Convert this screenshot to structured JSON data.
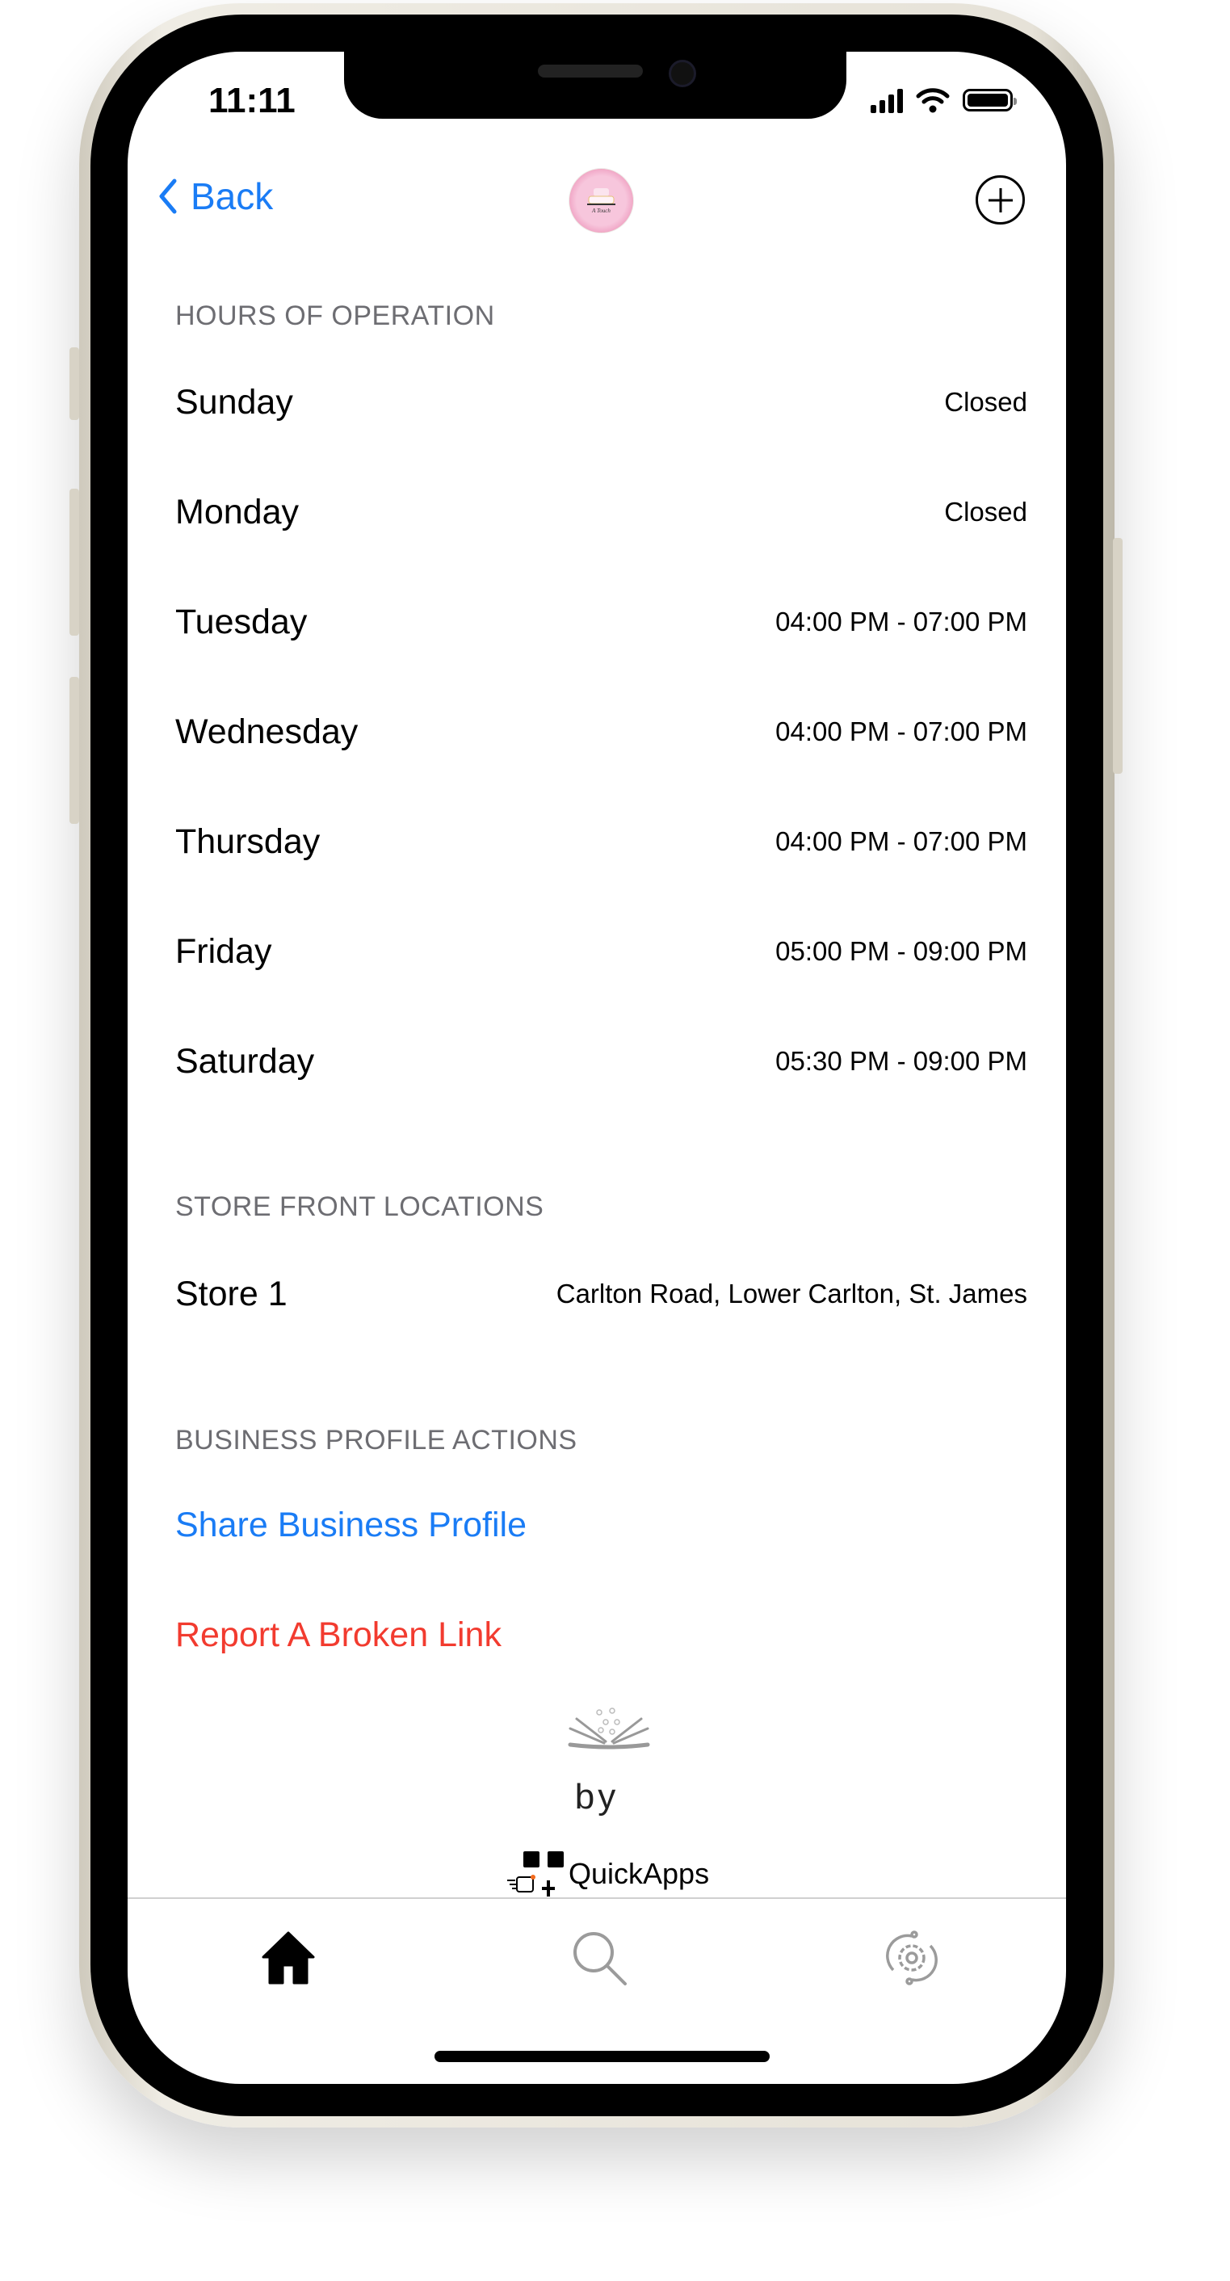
{
  "status_bar": {
    "time": "11:11"
  },
  "nav": {
    "back_label": "Back",
    "logo_text": "A Touch of Sweet",
    "add_icon": "plus-circle-icon"
  },
  "hours": {
    "header": "HOURS OF OPERATION",
    "rows": [
      {
        "day": "Sunday",
        "value": "Closed"
      },
      {
        "day": "Monday",
        "value": "Closed"
      },
      {
        "day": "Tuesday",
        "value": "04:00 PM - 07:00 PM"
      },
      {
        "day": "Wednesday",
        "value": "04:00 PM - 07:00 PM"
      },
      {
        "day": "Thursday",
        "value": "04:00 PM - 07:00 PM"
      },
      {
        "day": "Friday",
        "value": "05:00 PM - 09:00 PM"
      },
      {
        "day": "Saturday",
        "value": "05:30 PM - 09:00 PM"
      }
    ]
  },
  "locations": {
    "header": "STORE FRONT LOCATIONS",
    "rows": [
      {
        "name": "Store 1",
        "address": "Carlton Road, Lower Carlton, St. James"
      }
    ]
  },
  "actions": {
    "header": "BUSINESS PROFILE ACTIONS",
    "share": "Share Business Profile",
    "report": "Report A Broken Link"
  },
  "footer": {
    "by": "by",
    "brand": "QuickApps"
  },
  "tabs": [
    {
      "icon": "home-icon",
      "active": true
    },
    {
      "icon": "search-icon",
      "active": false
    },
    {
      "icon": "settings-gear-icon",
      "active": false
    }
  ],
  "colors": {
    "link": "#1a7cf5",
    "danger": "#f23b2f",
    "section": "#6d6d72",
    "tab_inactive": "#9b9b9b"
  }
}
